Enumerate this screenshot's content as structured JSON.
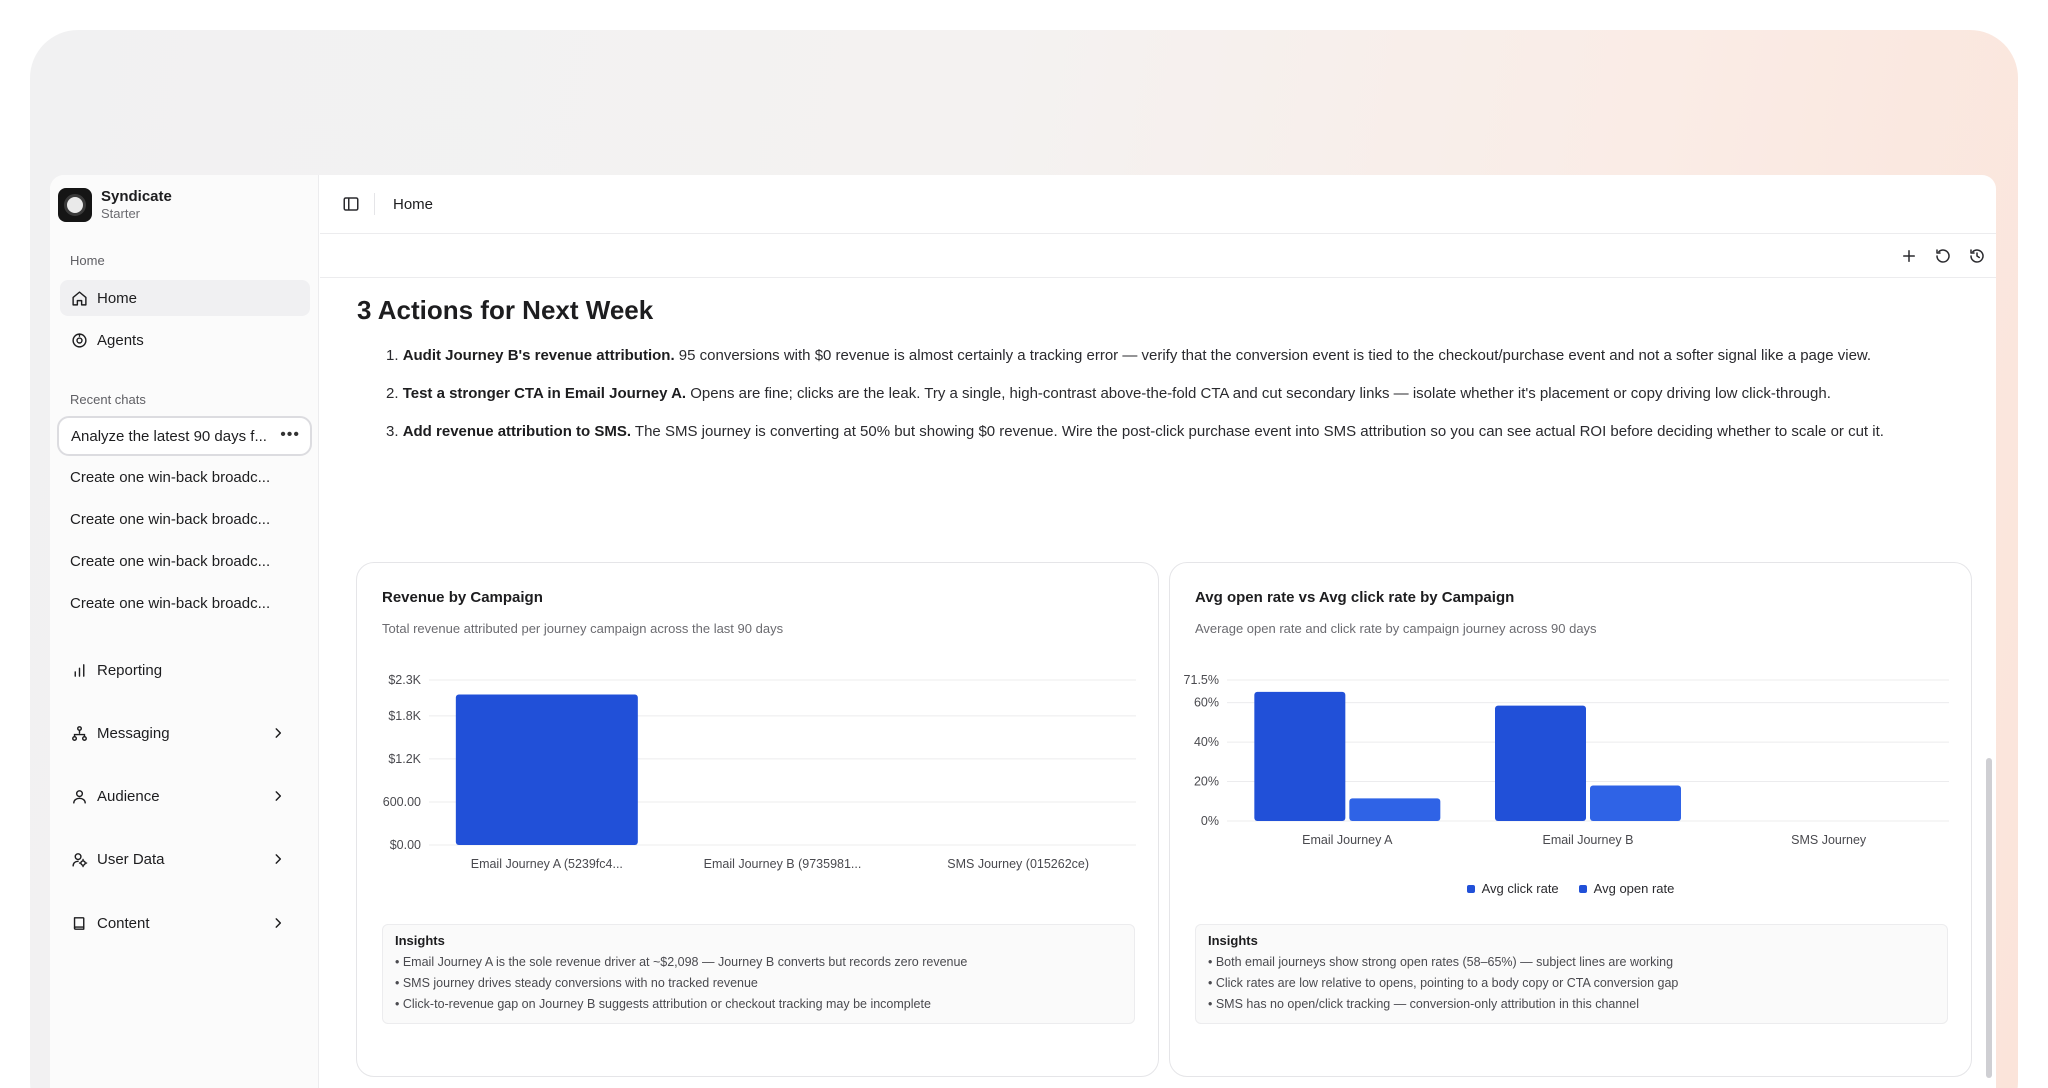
{
  "app": {
    "name": "Syndicate",
    "plan": "Starter"
  },
  "sidebar": {
    "section_home": "Home",
    "nav": [
      {
        "label": "Home",
        "icon": "home-icon",
        "active": true
      },
      {
        "label": "Agents",
        "icon": "agents-icon",
        "active": false
      }
    ],
    "section_recent": "Recent chats",
    "recent_chats": [
      "Analyze the latest 90 days f...",
      "Create one win-back broadc...",
      "Create one win-back broadc...",
      "Create one win-back broadc...",
      "Create one win-back broadc..."
    ],
    "bottom_nav": [
      {
        "label": "Reporting",
        "icon": "bar-chart-icon",
        "has_chevron": false
      },
      {
        "label": "Messaging",
        "icon": "workflow-icon",
        "has_chevron": true
      },
      {
        "label": "Audience",
        "icon": "person-icon",
        "has_chevron": true
      },
      {
        "label": "User Data",
        "icon": "user-data-icon",
        "has_chevron": true
      },
      {
        "label": "Content",
        "icon": "book-icon",
        "has_chevron": true
      }
    ]
  },
  "topbar": {
    "breadcrumb": "Home"
  },
  "content": {
    "heading": "3 Actions for Next Week",
    "actions": [
      {
        "num": "1.",
        "bold": "Audit Journey B's revenue attribution.",
        "text": " 95 conversions with $0 revenue is almost certainly a tracking error — verify that the conversion event is tied to the checkout/purchase event and not a softer signal like a page view."
      },
      {
        "num": "2.",
        "bold": "Test a stronger CTA in Email Journey A.",
        "text": " Opens are fine; clicks are the leak. Try a single, high-contrast above-the-fold CTA and cut secondary links — isolate whether it's placement or copy driving low click-through."
      },
      {
        "num": "3.",
        "bold": "Add revenue attribution to SMS.",
        "text": " The SMS journey is converting at 50% but showing $0 revenue. Wire the post-click purchase event into SMS attribution so you can see actual ROI before deciding whether to scale or cut it."
      }
    ]
  },
  "charts": [
    {
      "title": "Revenue by Campaign",
      "subtitle": "Total revenue attributed per journey campaign across the last 90 days",
      "insights_title": "Insights",
      "insights": [
        "• Email Journey A is the sole revenue driver at ~$2,098 — Journey B converts but records zero revenue",
        "• SMS journey drives steady conversions with no tracked revenue",
        "• Click-to-revenue gap on Journey B suggests attribution or checkout tracking may be incomplete"
      ]
    },
    {
      "title": "Avg open rate vs Avg click rate by Campaign",
      "subtitle": "Average open rate and click rate by campaign journey across 90 days",
      "insights_title": "Insights",
      "insights": [
        "• Both email journeys show strong open rates (58–65%) — subject lines are working",
        "• Click rates are low relative to opens, pointing to a body copy or CTA conversion gap",
        "• SMS has no open/click tracking — conversion-only attribution in this channel"
      ]
    }
  ],
  "chart_data": [
    {
      "type": "bar",
      "title": "Revenue by Campaign",
      "categories": [
        "Email Journey A (5239fc4...",
        "Email Journey B (9735981...",
        "SMS Journey (015262ce)"
      ],
      "values": [
        2098,
        0,
        0
      ],
      "y_ticks": [
        "$0.00",
        "600.00",
        "$1.2K",
        "$1.8K",
        "$2.3K"
      ],
      "y_tick_values": [
        0,
        600,
        1200,
        1800,
        2300
      ],
      "ylim": [
        0,
        2300
      ],
      "color": "#2150d8",
      "grid": true
    },
    {
      "type": "bar",
      "title": "Avg open rate vs Avg click rate by Campaign",
      "categories": [
        "Email Journey A",
        "Email Journey B",
        "SMS Journey"
      ],
      "series": [
        {
          "name": "Avg open rate",
          "values": [
            65.5,
            58.5,
            0
          ],
          "color": "#2150d8"
        },
        {
          "name": "Avg click rate",
          "values": [
            11.5,
            18,
            0
          ],
          "color": "#2f63e6"
        }
      ],
      "legend_order": [
        "Avg click rate",
        "Avg open rate"
      ],
      "legend_colors": [
        "#2150d8",
        "#2150d8"
      ],
      "y_ticks": [
        "0%",
        "20%",
        "40%",
        "60%",
        "71.5%"
      ],
      "y_tick_values": [
        0,
        20,
        40,
        60,
        71.5
      ],
      "ylim": [
        0,
        71.5
      ],
      "grid": true,
      "legend_position": "bottom-center"
    }
  ]
}
